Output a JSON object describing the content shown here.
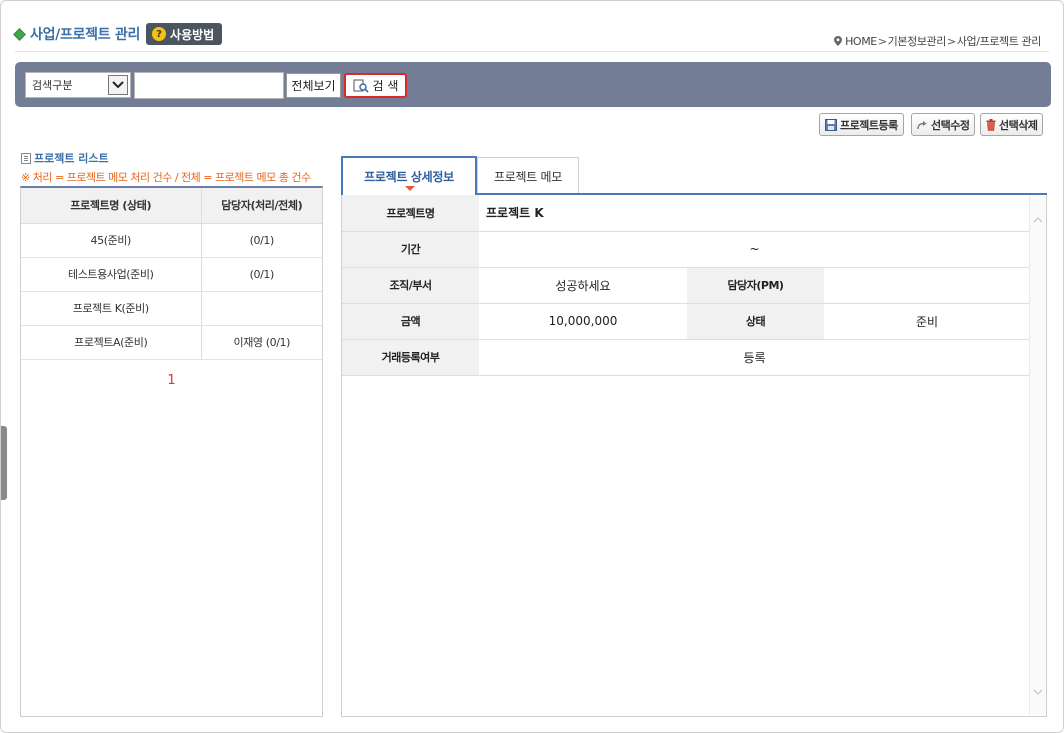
{
  "header": {
    "title": "사업/프로젝트 관리",
    "usage_label": "사용방법",
    "breadcrumb": [
      "HOME",
      "기본정보관리",
      "사업/프로젝트 관리"
    ]
  },
  "search": {
    "select_value": "검색구분",
    "input_value": "",
    "viewall_label": "전체보기",
    "search_label": "검 색"
  },
  "actions": {
    "register_label": "프로젝트등록",
    "edit_label": "선택수정",
    "delete_label": "선택삭제"
  },
  "list": {
    "title": "프로젝트 리스트",
    "note": "※ 처리 = 프로젝트 메모 처리 건수 / 전체 = 프로젝트 메모 총 건수",
    "columns": [
      "프로젝트명 (상태)",
      "담당자(처리/전체)"
    ],
    "rows": [
      [
        "45(준비)",
        "(0/1)"
      ],
      [
        "테스트용사업(준비)",
        "(0/1)"
      ],
      [
        "프로젝트 K(준비)",
        ""
      ],
      [
        "프로젝트A(준비)",
        "이재영 (0/1)"
      ]
    ],
    "page": "1"
  },
  "tabs": {
    "detail": "프로젝트 상세정보",
    "memo": "프로젝트 메모"
  },
  "detail": {
    "name_label": "프로젝트명",
    "name_value": "프로젝트 K",
    "period_label": "기간",
    "period_value": "~",
    "org_label": "조직/부서",
    "org_value": "성공하세요",
    "manager_label": "담당자(PM)",
    "manager_value": "",
    "amount_label": "금액",
    "amount_value": "10,000,000",
    "status_label": "상태",
    "status_value": "준비",
    "trade_label": "거래등록여부",
    "trade_value": "등록"
  },
  "colors": {
    "search_bar": "#747d96",
    "tab_accent": "#4a79b7",
    "note_orange": "#e8661a",
    "search_btn_border": "#d9292b"
  }
}
